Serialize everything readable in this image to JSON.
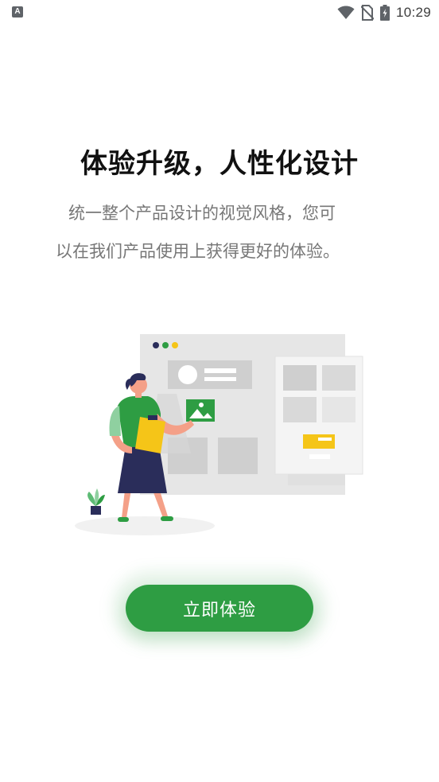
{
  "status_bar": {
    "time": "10:29",
    "left_icon": "A",
    "icons": [
      "wifi-icon",
      "no-sim-icon",
      "battery-charging-icon"
    ]
  },
  "intro": {
    "title": "体验升级，人性化设计",
    "description_line1": "统一整个产品设计的视觉风格，您可",
    "description_line2": "以在我们产品使用上获得更好的体验。"
  },
  "cta": {
    "label": "立即体验"
  },
  "colors": {
    "accent": "#2e9d43",
    "yellow": "#f5c518",
    "navy": "#2a2d5a",
    "panel_gray": "#e6e6e6"
  }
}
